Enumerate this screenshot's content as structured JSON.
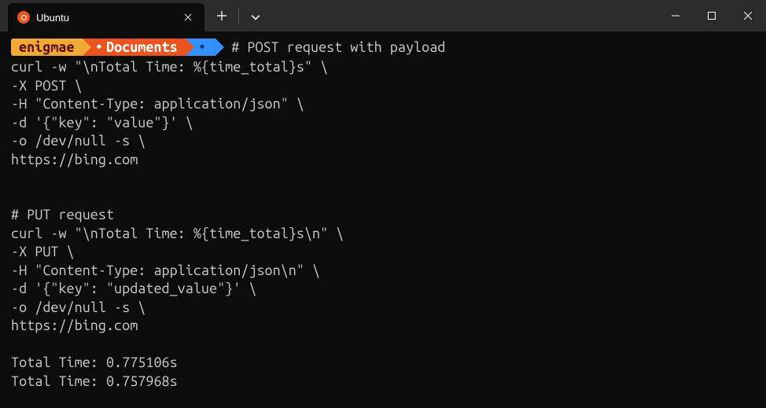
{
  "window": {
    "tab_title": "Ubuntu"
  },
  "prompt": {
    "user": "enigmae",
    "path": "Documents",
    "path_icon": "◆",
    "git_icon": "◆",
    "command": "# POST request with payload"
  },
  "terminal_output": "curl -w \"\\nTotal Time: %{time_total}s\" \\\n-X POST \\\n-H \"Content-Type: application/json\" \\\n-d '{\"key\": \"value\"}' \\\n-o /dev/null -s \\\nhttps://bing.com\n\n\n# PUT request\ncurl -w \"\\nTotal Time: %{time_total}s\\n\" \\\n-X PUT \\\n-H \"Content-Type: application/json\\n\" \\\n-d '{\"key\": \"updated_value\"}' \\\n-o /dev/null -s \\\nhttps://bing.com\n\nTotal Time: 0.775106s\nTotal Time: 0.757968s"
}
